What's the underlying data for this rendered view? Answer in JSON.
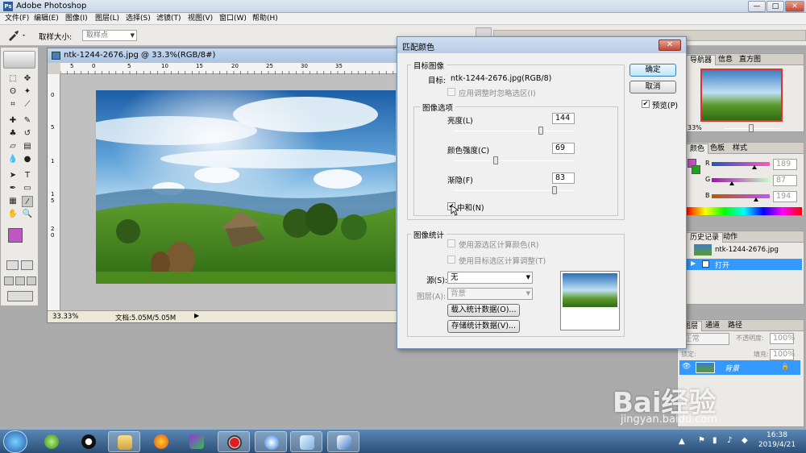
{
  "app": {
    "title": "Adobe Photoshop",
    "logo": "Ps"
  },
  "window_buttons": {
    "min": "—",
    "max": "□",
    "close": "✕"
  },
  "menu": [
    "文件(F)",
    "编辑(E)",
    "图像(I)",
    "图层(L)",
    "选择(S)",
    "滤镜(T)",
    "视图(V)",
    "窗口(W)",
    "帮助(H)"
  ],
  "options_bar": {
    "sample_size_label": "取样大小:",
    "sample_size_value": "取样点"
  },
  "document": {
    "title": "ntk-1244-2676.jpg @ 33.3%(RGB/8#)",
    "zoom": "33.33%",
    "doc_size": "文档:5.05M/5.05M",
    "ruler_marks_top": [
      "5",
      "0",
      "5",
      "10",
      "15",
      "20",
      "25",
      "30",
      "35"
    ],
    "ruler_marks_left": [
      "0",
      "5",
      "1",
      "1",
      "5",
      "2",
      "0"
    ]
  },
  "dialog": {
    "title": "匹配颜色",
    "close": "✕",
    "target_group": "目标图像",
    "target_label": "目标:",
    "target_value": "ntk-1244-2676.jpg(RGB/8)",
    "ignore_selection": "应用调整时忽略选区(I)",
    "options_group": "图像选项",
    "luminance_label": "亮度(L)",
    "luminance_value": "144",
    "luminance": 144,
    "luminance_max": 200,
    "intensity_label": "颜色强度(C)",
    "intensity_value": "69",
    "intensity": 69,
    "intensity_max": 200,
    "fade_label": "渐隐(F)",
    "fade_value": "83",
    "fade": 83,
    "fade_max": 100,
    "neutralize_label": "中和(N)",
    "neutralize_checked": "✔",
    "stats_group": "图像统计",
    "use_source_selection": "使用源选区计算颜色(R)",
    "use_target_selection": "使用目标选区计算调整(T)",
    "source_label": "源(S):",
    "source_value": "无",
    "layer_label": "图层(A):",
    "layer_value": "背景",
    "load_stats": "载入统计数据(O)...",
    "save_stats": "存储统计数据(V)...",
    "ok": "确定",
    "cancel": "取消",
    "preview_label": "预览(P)",
    "preview_checked": "✔"
  },
  "panels": {
    "navigator": {
      "tabs": [
        "导航器",
        "信息",
        "直方图"
      ],
      "zoom": "33%"
    },
    "color": {
      "tabs": [
        "颜色",
        "色板",
        "样式"
      ],
      "r_label": "R",
      "r_value": "189",
      "r": 189,
      "g_label": "G",
      "g_value": "87",
      "g": 87,
      "b_label": "B",
      "b_value": "194",
      "b": 194,
      "fg_color": "#bd57c2",
      "bg_color": "#1aa51a"
    },
    "history": {
      "tabs": [
        "历史记录",
        "动作"
      ],
      "snapshot": "ntk-1244-2676.jpg",
      "step": "打开"
    },
    "layers": {
      "tabs": [
        "图层",
        "通道",
        "路径"
      ],
      "blend": "正常",
      "opacity_label": "不透明度:",
      "opacity": "100%",
      "lock_label": "锁定:",
      "fill_label": "填充:",
      "fill": "100%",
      "layer_name": "背景"
    }
  },
  "taskbar": {
    "time": "16:38",
    "date": "2019/4/21",
    "apps": [
      "start",
      "green-sphere",
      "qq",
      "folder",
      "firefox",
      "video-player",
      "record",
      "network",
      "paper",
      "photoshop"
    ]
  },
  "watermark": {
    "logo": "Bai经验",
    "url": "jingyan.baidu.com"
  },
  "colors": {
    "dialog_accent": "#3c7fb1",
    "selection": "#3399ff",
    "titlebar": "#c7d6e8"
  }
}
